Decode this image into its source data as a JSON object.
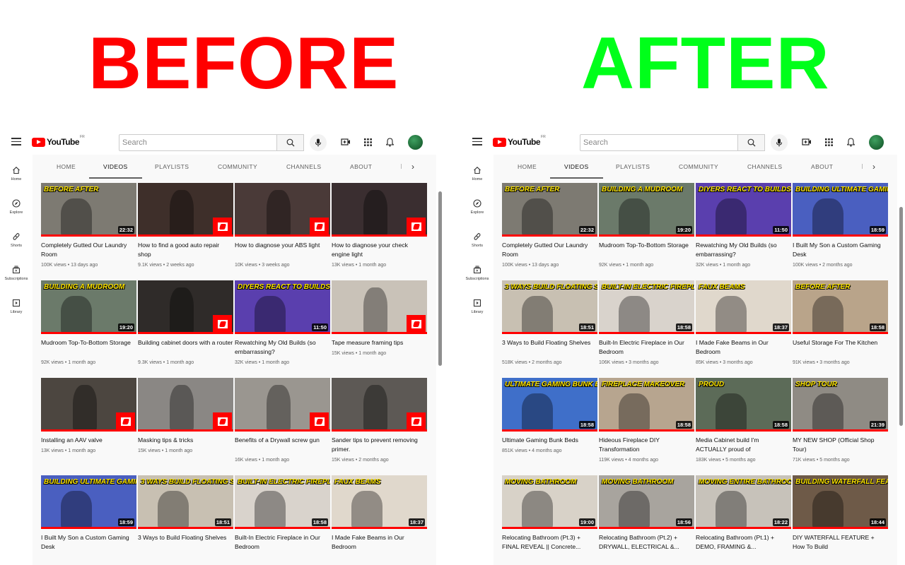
{
  "headings": {
    "before": "BEFORE",
    "after": "AFTER"
  },
  "colors": {
    "before": "#ff0000",
    "after": "#00ff1a",
    "accent": "#ff0000"
  },
  "youtube": {
    "logo_word": "YouTube",
    "logo_region": "FR",
    "search_placeholder": "Search",
    "sidebar": [
      {
        "label": "Home",
        "icon": "home-icon"
      },
      {
        "label": "Explore",
        "icon": "compass-icon"
      },
      {
        "label": "Shorts",
        "icon": "shorts-icon"
      },
      {
        "label": "Subscriptions",
        "icon": "subscriptions-icon"
      },
      {
        "label": "Library",
        "icon": "library-icon"
      }
    ],
    "tabs": [
      "HOME",
      "VIDEOS",
      "PLAYLISTS",
      "COMMUNITY",
      "CHANNELS",
      "ABOUT"
    ],
    "active_tab": "VIDEOS"
  },
  "before_videos": [
    {
      "title": "Completely Gutted Our Laundry Room",
      "meta": "100K views • 13 days ago",
      "duration": "22:32",
      "thumb_text": "BEFORE  AFTER",
      "bg": "#7d7a72",
      "shorts": false
    },
    {
      "title": "How to find a good auto repair shop",
      "meta": "9.1K views • 2 weeks ago",
      "duration": "",
      "thumb_text": "",
      "bg": "#3e2f2a",
      "shorts": true
    },
    {
      "title": "How to diagnose your ABS light",
      "meta": "10K views • 3 weeks ago",
      "duration": "",
      "thumb_text": "",
      "bg": "#4a3a38",
      "shorts": true
    },
    {
      "title": "How to diagnose your check engine light",
      "meta": "13K views • 1 month ago",
      "duration": "",
      "thumb_text": "",
      "bg": "#3a2e30",
      "shorts": true
    },
    {
      "title": "Mudroom Top-To-Bottom Storage",
      "meta": "92K views • 1 month ago",
      "duration": "19:20",
      "thumb_text": "BUILDING A MUDROOM",
      "bg": "#6b7a6a",
      "shorts": false
    },
    {
      "title": "Building cabinet doors with a router",
      "meta": "9.3K views • 1 month ago",
      "duration": "",
      "thumb_text": "",
      "bg": "#2f2b29",
      "shorts": true
    },
    {
      "title": "Rewatching My Old Builds (so embarrassing?",
      "meta": "32K views • 1 month ago",
      "duration": "11:50",
      "thumb_text": "DIYERS REACT TO BUILDS",
      "bg": "#5a3fae",
      "shorts": false
    },
    {
      "title": "Tape measure framing tips",
      "meta": "15K views • 1 month ago",
      "duration": "",
      "thumb_text": "",
      "bg": "#c9c2b8",
      "shorts": true
    },
    {
      "title": "Installing an AAV valve",
      "meta": "13K views • 1 month ago",
      "duration": "",
      "thumb_text": "",
      "bg": "#4c4640",
      "shorts": true
    },
    {
      "title": "Masking tips & tricks",
      "meta": "15K views • 1 month ago",
      "duration": "",
      "thumb_text": "",
      "bg": "#8a8784",
      "shorts": true
    },
    {
      "title": "Benefits of a Drywall screw gun",
      "meta": "16K views • 1 month ago",
      "duration": "",
      "thumb_text": "",
      "bg": "#9a9690",
      "shorts": true
    },
    {
      "title": "Sander tips to prevent removing primer.",
      "meta": "15K views • 2 months ago",
      "duration": "",
      "thumb_text": "",
      "bg": "#5d5955",
      "shorts": true
    },
    {
      "title": "I Built My Son a Custom Gaming Desk",
      "meta": "",
      "duration": "18:59",
      "thumb_text": "BUILDING ULTIMATE GAMING DESK",
      "bg": "#4a5fc0",
      "shorts": false
    },
    {
      "title": "3 Ways to Build Floating Shelves",
      "meta": "",
      "duration": "18:51",
      "thumb_text": "3 WAYS BUILD FLOATING SHELVES",
      "bg": "#c8c0b2",
      "shorts": false
    },
    {
      "title": "Built-In Electric Fireplace in Our Bedroom",
      "meta": "",
      "duration": "18:58",
      "thumb_text": "BUILT-IN ELECTRIC FIREPLACE MANTEL",
      "bg": "#d9d3cc",
      "shorts": false
    },
    {
      "title": "I Made Fake Beams in Our Bedroom",
      "meta": "",
      "duration": "18:37",
      "thumb_text": "FAUX BEAMS",
      "bg": "#e0d8cc",
      "shorts": false
    }
  ],
  "after_videos": [
    {
      "title": "Completely Gutted Our Laundry Room",
      "meta": "100K views • 13 days ago",
      "duration": "22:32",
      "thumb_text": "BEFORE  AFTER",
      "bg": "#7d7a72",
      "shorts": false
    },
    {
      "title": "Mudroom Top-To-Bottom Storage",
      "meta": "92K views • 1 month ago",
      "duration": "19:20",
      "thumb_text": "BUILDING A MUDROOM",
      "bg": "#6b7a6a",
      "shorts": false
    },
    {
      "title": "Rewatching My Old Builds (so embarrassing?",
      "meta": "32K views • 1 month ago",
      "duration": "11:50",
      "thumb_text": "DIYERS REACT TO BUILDS",
      "bg": "#5a3fae",
      "shorts": false
    },
    {
      "title": "I Built My Son a Custom Gaming Desk",
      "meta": "100K views • 2 months ago",
      "duration": "18:59",
      "thumb_text": "BUILDING ULTIMATE GAMING DESK",
      "bg": "#4a5fc0",
      "shorts": false
    },
    {
      "title": "3 Ways to Build Floating Shelves",
      "meta": "518K views • 2 months ago",
      "duration": "18:51",
      "thumb_text": "3 WAYS BUILD FLOATING SHELVES",
      "bg": "#c8c0b2",
      "shorts": false
    },
    {
      "title": "Built-In Electric Fireplace in Our Bedroom",
      "meta": "106K views • 3 months ago",
      "duration": "18:58",
      "thumb_text": "BUILT-IN ELECTRIC FIREPLACE MANTEL",
      "bg": "#d9d3cc",
      "shorts": false
    },
    {
      "title": "I Made Fake Beams in Our Bedroom",
      "meta": "85K views • 3 months ago",
      "duration": "18:37",
      "thumb_text": "FAUX BEAMS",
      "bg": "#e0d8cc",
      "shorts": false
    },
    {
      "title": "Useful Storage For The Kitchen",
      "meta": "91K views • 3 months ago",
      "duration": "18:58",
      "thumb_text": "BEFORE  AFTER",
      "bg": "#b9a48a",
      "shorts": false
    },
    {
      "title": "Ultimate Gaming Bunk Beds",
      "meta": "851K views • 4 months ago",
      "duration": "18:58",
      "thumb_text": "ULTIMATE GAMING BUNK BED",
      "bg": "#3f6fc9",
      "shorts": false
    },
    {
      "title": "Hideous Fireplace DIY Transformation",
      "meta": "119K views • 4 months ago",
      "duration": "18:58",
      "thumb_text": "FIREPLACE MAKEOVER",
      "bg": "#b7a58f",
      "shorts": false
    },
    {
      "title": "Media Cabinet build I'm ACTUALLY proud of",
      "meta": "183K views • 5 months ago",
      "duration": "18:58",
      "thumb_text": "PROUD",
      "bg": "#5c6b58",
      "shorts": false
    },
    {
      "title": "MY NEW SHOP (Official Shop Tour)",
      "meta": "71K views • 5 months ago",
      "duration": "21:39",
      "thumb_text": "SHOP TOUR",
      "bg": "#8f8b84",
      "shorts": false
    },
    {
      "title": "Relocating Bathroom (Pt.3) + FINAL REVEAL || Concrete...",
      "meta": "",
      "duration": "19:00",
      "thumb_text": "MOVING BATHROOM",
      "bg": "#d8d2c8",
      "shorts": false
    },
    {
      "title": "Relocating Bathroom (Pt.2) + DRYWALL, ELECTRICAL &...",
      "meta": "",
      "duration": "18:56",
      "thumb_text": "MOVING BATHROOM",
      "bg": "#a8a49e",
      "shorts": false
    },
    {
      "title": "Relocating Bathroom (Pt.1) + DEMO, FRAMING &...",
      "meta": "",
      "duration": "18:22",
      "thumb_text": "MOVING ENTIRE BATHROOM",
      "bg": "#c7c2ba",
      "shorts": false
    },
    {
      "title": "DIY WATERFALL FEATURE + How To Build",
      "meta": "",
      "duration": "18:44",
      "thumb_text": "BUILDING WATERFALL FEATURE",
      "bg": "#6e5a48",
      "shorts": false
    }
  ]
}
